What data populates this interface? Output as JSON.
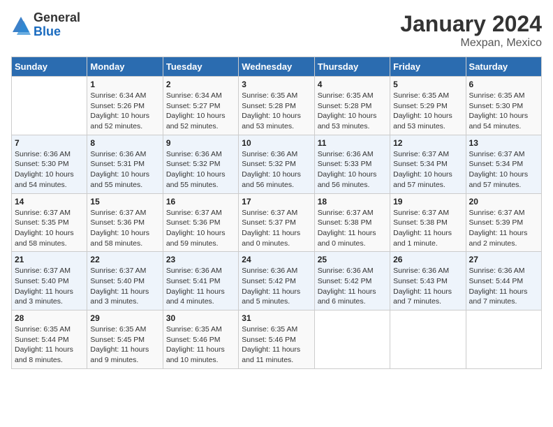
{
  "header": {
    "logo_general": "General",
    "logo_blue": "Blue",
    "title": "January 2024",
    "subtitle": "Mexpan, Mexico"
  },
  "days_of_week": [
    "Sunday",
    "Monday",
    "Tuesday",
    "Wednesday",
    "Thursday",
    "Friday",
    "Saturday"
  ],
  "weeks": [
    [
      {
        "day": "",
        "sunrise": "",
        "sunset": "",
        "daylight": ""
      },
      {
        "day": "1",
        "sunrise": "Sunrise: 6:34 AM",
        "sunset": "Sunset: 5:26 PM",
        "daylight": "Daylight: 10 hours and 52 minutes."
      },
      {
        "day": "2",
        "sunrise": "Sunrise: 6:34 AM",
        "sunset": "Sunset: 5:27 PM",
        "daylight": "Daylight: 10 hours and 52 minutes."
      },
      {
        "day": "3",
        "sunrise": "Sunrise: 6:35 AM",
        "sunset": "Sunset: 5:28 PM",
        "daylight": "Daylight: 10 hours and 53 minutes."
      },
      {
        "day": "4",
        "sunrise": "Sunrise: 6:35 AM",
        "sunset": "Sunset: 5:28 PM",
        "daylight": "Daylight: 10 hours and 53 minutes."
      },
      {
        "day": "5",
        "sunrise": "Sunrise: 6:35 AM",
        "sunset": "Sunset: 5:29 PM",
        "daylight": "Daylight: 10 hours and 53 minutes."
      },
      {
        "day": "6",
        "sunrise": "Sunrise: 6:35 AM",
        "sunset": "Sunset: 5:30 PM",
        "daylight": "Daylight: 10 hours and 54 minutes."
      }
    ],
    [
      {
        "day": "7",
        "sunrise": "Sunrise: 6:36 AM",
        "sunset": "Sunset: 5:30 PM",
        "daylight": "Daylight: 10 hours and 54 minutes."
      },
      {
        "day": "8",
        "sunrise": "Sunrise: 6:36 AM",
        "sunset": "Sunset: 5:31 PM",
        "daylight": "Daylight: 10 hours and 55 minutes."
      },
      {
        "day": "9",
        "sunrise": "Sunrise: 6:36 AM",
        "sunset": "Sunset: 5:32 PM",
        "daylight": "Daylight: 10 hours and 55 minutes."
      },
      {
        "day": "10",
        "sunrise": "Sunrise: 6:36 AM",
        "sunset": "Sunset: 5:32 PM",
        "daylight": "Daylight: 10 hours and 56 minutes."
      },
      {
        "day": "11",
        "sunrise": "Sunrise: 6:36 AM",
        "sunset": "Sunset: 5:33 PM",
        "daylight": "Daylight: 10 hours and 56 minutes."
      },
      {
        "day": "12",
        "sunrise": "Sunrise: 6:37 AM",
        "sunset": "Sunset: 5:34 PM",
        "daylight": "Daylight: 10 hours and 57 minutes."
      },
      {
        "day": "13",
        "sunrise": "Sunrise: 6:37 AM",
        "sunset": "Sunset: 5:34 PM",
        "daylight": "Daylight: 10 hours and 57 minutes."
      }
    ],
    [
      {
        "day": "14",
        "sunrise": "Sunrise: 6:37 AM",
        "sunset": "Sunset: 5:35 PM",
        "daylight": "Daylight: 10 hours and 58 minutes."
      },
      {
        "day": "15",
        "sunrise": "Sunrise: 6:37 AM",
        "sunset": "Sunset: 5:36 PM",
        "daylight": "Daylight: 10 hours and 58 minutes."
      },
      {
        "day": "16",
        "sunrise": "Sunrise: 6:37 AM",
        "sunset": "Sunset: 5:36 PM",
        "daylight": "Daylight: 10 hours and 59 minutes."
      },
      {
        "day": "17",
        "sunrise": "Sunrise: 6:37 AM",
        "sunset": "Sunset: 5:37 PM",
        "daylight": "Daylight: 11 hours and 0 minutes."
      },
      {
        "day": "18",
        "sunrise": "Sunrise: 6:37 AM",
        "sunset": "Sunset: 5:38 PM",
        "daylight": "Daylight: 11 hours and 0 minutes."
      },
      {
        "day": "19",
        "sunrise": "Sunrise: 6:37 AM",
        "sunset": "Sunset: 5:38 PM",
        "daylight": "Daylight: 11 hours and 1 minute."
      },
      {
        "day": "20",
        "sunrise": "Sunrise: 6:37 AM",
        "sunset": "Sunset: 5:39 PM",
        "daylight": "Daylight: 11 hours and 2 minutes."
      }
    ],
    [
      {
        "day": "21",
        "sunrise": "Sunrise: 6:37 AM",
        "sunset": "Sunset: 5:40 PM",
        "daylight": "Daylight: 11 hours and 3 minutes."
      },
      {
        "day": "22",
        "sunrise": "Sunrise: 6:37 AM",
        "sunset": "Sunset: 5:40 PM",
        "daylight": "Daylight: 11 hours and 3 minutes."
      },
      {
        "day": "23",
        "sunrise": "Sunrise: 6:36 AM",
        "sunset": "Sunset: 5:41 PM",
        "daylight": "Daylight: 11 hours and 4 minutes."
      },
      {
        "day": "24",
        "sunrise": "Sunrise: 6:36 AM",
        "sunset": "Sunset: 5:42 PM",
        "daylight": "Daylight: 11 hours and 5 minutes."
      },
      {
        "day": "25",
        "sunrise": "Sunrise: 6:36 AM",
        "sunset": "Sunset: 5:42 PM",
        "daylight": "Daylight: 11 hours and 6 minutes."
      },
      {
        "day": "26",
        "sunrise": "Sunrise: 6:36 AM",
        "sunset": "Sunset: 5:43 PM",
        "daylight": "Daylight: 11 hours and 7 minutes."
      },
      {
        "day": "27",
        "sunrise": "Sunrise: 6:36 AM",
        "sunset": "Sunset: 5:44 PM",
        "daylight": "Daylight: 11 hours and 7 minutes."
      }
    ],
    [
      {
        "day": "28",
        "sunrise": "Sunrise: 6:35 AM",
        "sunset": "Sunset: 5:44 PM",
        "daylight": "Daylight: 11 hours and 8 minutes."
      },
      {
        "day": "29",
        "sunrise": "Sunrise: 6:35 AM",
        "sunset": "Sunset: 5:45 PM",
        "daylight": "Daylight: 11 hours and 9 minutes."
      },
      {
        "day": "30",
        "sunrise": "Sunrise: 6:35 AM",
        "sunset": "Sunset: 5:46 PM",
        "daylight": "Daylight: 11 hours and 10 minutes."
      },
      {
        "day": "31",
        "sunrise": "Sunrise: 6:35 AM",
        "sunset": "Sunset: 5:46 PM",
        "daylight": "Daylight: 11 hours and 11 minutes."
      },
      {
        "day": "",
        "sunrise": "",
        "sunset": "",
        "daylight": ""
      },
      {
        "day": "",
        "sunrise": "",
        "sunset": "",
        "daylight": ""
      },
      {
        "day": "",
        "sunrise": "",
        "sunset": "",
        "daylight": ""
      }
    ]
  ]
}
